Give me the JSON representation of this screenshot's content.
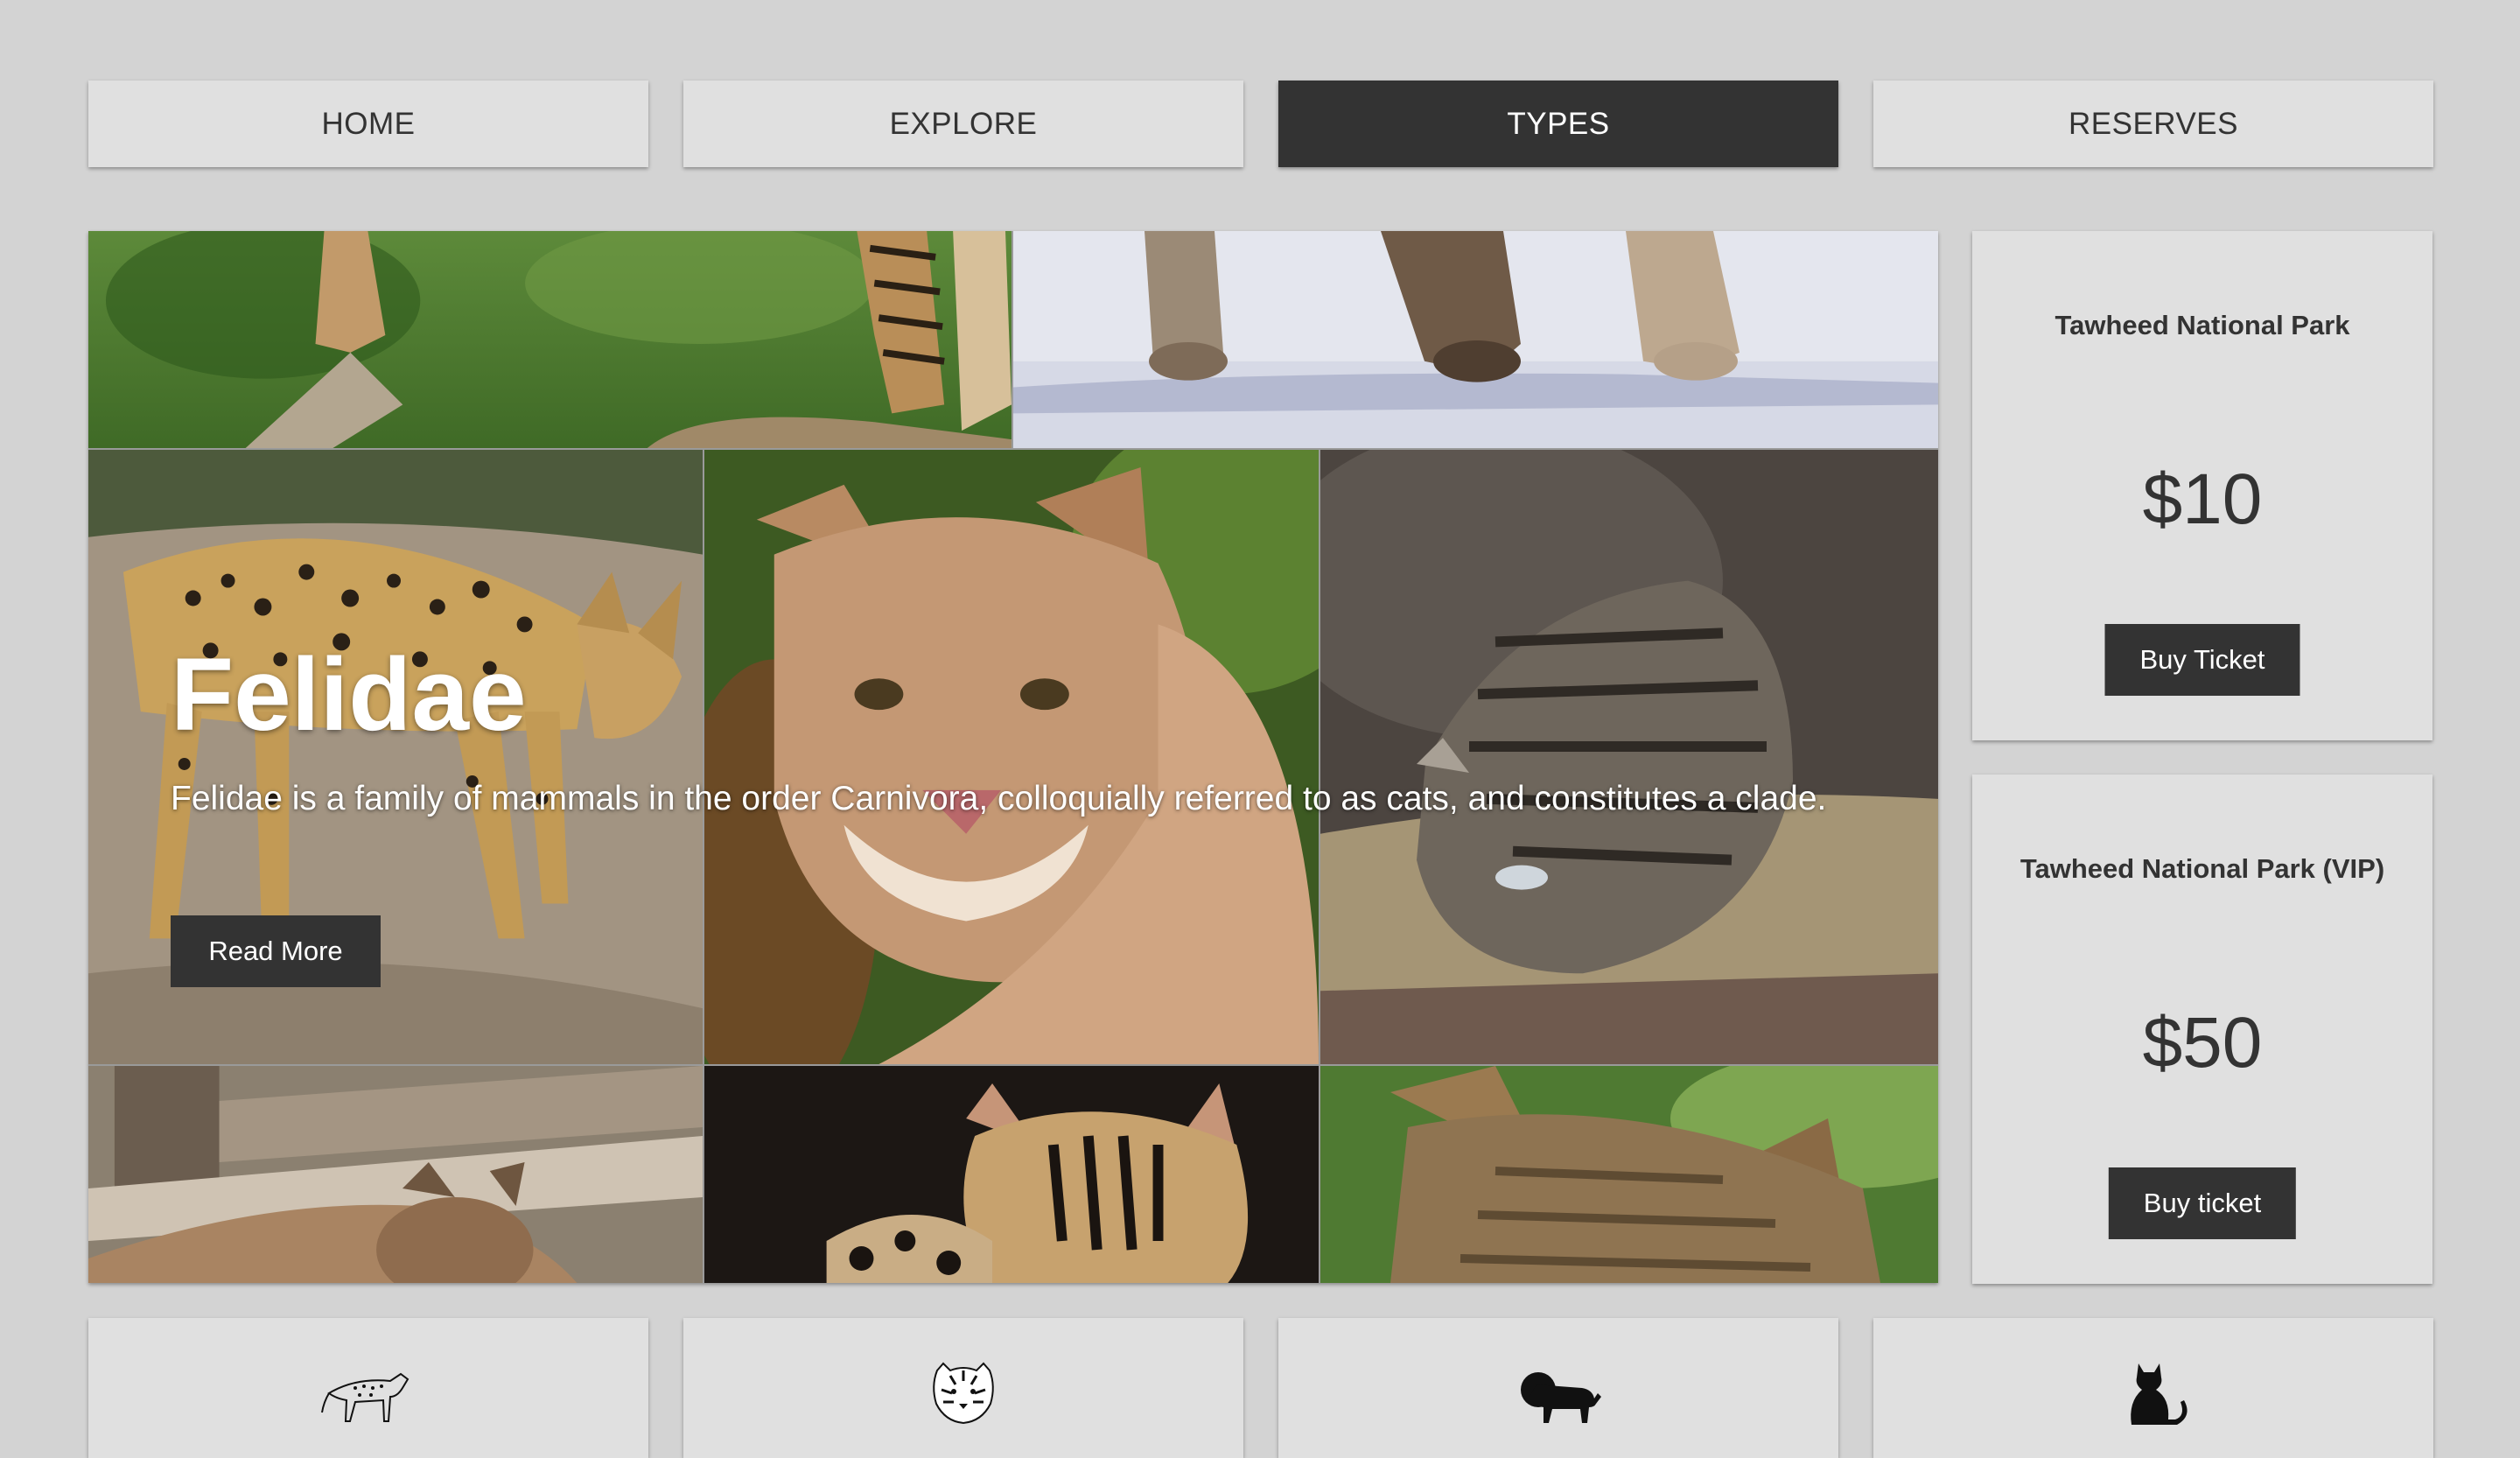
{
  "nav": {
    "items": [
      {
        "label": "HOME",
        "active": false
      },
      {
        "label": "EXPLORE",
        "active": false
      },
      {
        "label": "TYPES",
        "active": true
      },
      {
        "label": "RESERVES",
        "active": false
      }
    ]
  },
  "hero": {
    "title": "Felidae",
    "description": "Felidae is a family of mammals in the order Carnivora, colloquially referred to as cats, and constitutes a clade.",
    "button_label": "Read More"
  },
  "tickets": [
    {
      "name": "Tawheed National Park",
      "price": "$10",
      "button_label": "Buy Ticket"
    },
    {
      "name": "Tawheed National Park (VIP)",
      "price": "$50",
      "button_label": "Buy ticket"
    }
  ],
  "cards": [
    {
      "icon": "cheetah-icon"
    },
    {
      "icon": "tiger-icon"
    },
    {
      "icon": "lion-icon"
    },
    {
      "icon": "cat-icon"
    }
  ],
  "colors": {
    "background": "#d3d3d3",
    "panel": "#e0e0e0",
    "dark": "#333333",
    "text_light": "#ffffff"
  }
}
